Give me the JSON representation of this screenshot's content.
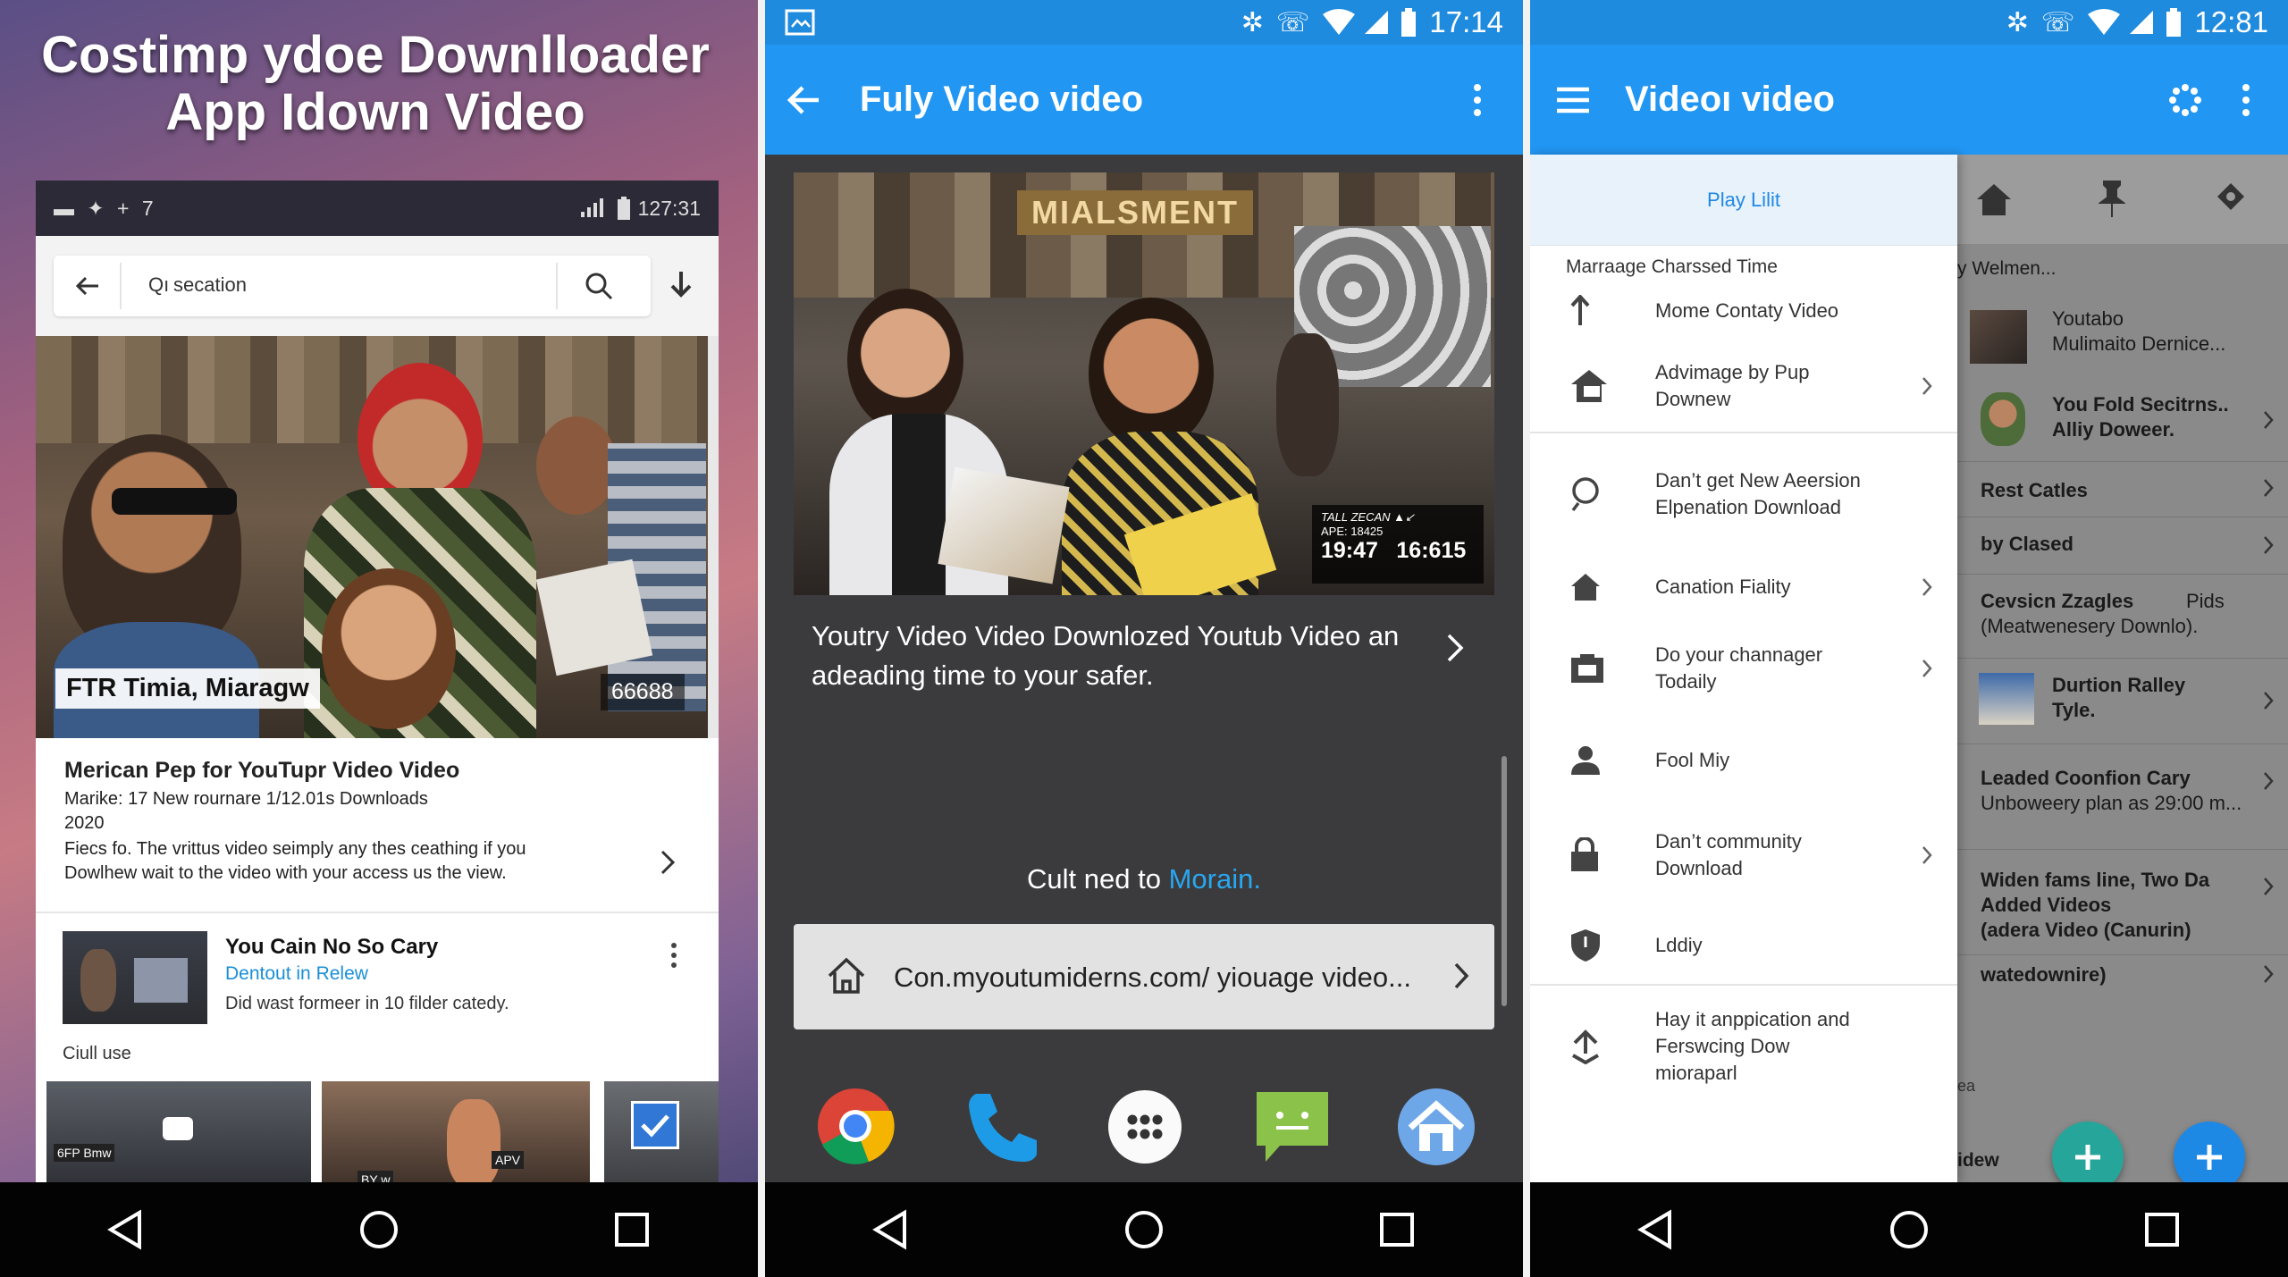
{
  "panel1": {
    "title_line1": "Costimp ydoe Downlloader",
    "title_line2": "App Idown Video",
    "status": {
      "left": "▬ ✦ + 7",
      "time": "127:31"
    },
    "search": {
      "query": "secation",
      "prefix": "Qı"
    },
    "hero": {
      "caption": "FTR Timia, Miaragw",
      "count": "66688"
    },
    "card": {
      "title": "Merican Pep for YouTupr Video Video",
      "meta": "Marike: 17 New rournare 1/12.01s Downloads",
      "year": "2020",
      "desc": "Fiecs fo. The vrittus video seimply any thes ceathing if you Dowlhew wait to the video with your access us the view."
    },
    "item": {
      "title": "You Cain No So Cary",
      "subtitle": "Dentout in Relew",
      "desc": "Did wast formeer in 10 filder catedy."
    },
    "section_label": "Ciull use",
    "thumbs": [
      "6FP  Bmw",
      "BY w",
      "APV"
    ]
  },
  "panel2": {
    "time": "17:14",
    "appbar_title": "Fuly Video video",
    "video": {
      "sign": "MIALSMENT",
      "overlay_label": "TALL ZECAN ▲↙",
      "overlay_sub": "APE: 18425",
      "time1": "19:47",
      "time2": "16:615"
    },
    "video_title": "Youtry Video Video Downlozed Youtub Video an adeading time to your safer.",
    "link_text_prefix": "Cult ned to ",
    "link_text_accent": "Morain.",
    "url": "Con.myoutumiderns.com/ yiouage video...",
    "dock": [
      "chrome-icon",
      "phone-icon",
      "apps-icon",
      "messages-icon",
      "home-app-icon"
    ]
  },
  "panel3": {
    "time": "12:81",
    "appbar_title": "Videoı video",
    "drawer": {
      "tab": "Play Lilit",
      "section": "Marraage Charssed Time",
      "items": [
        {
          "label": "Mome Contaty Video"
        },
        {
          "label": "Advimage by Pup Downew"
        },
        {
          "label": "Dan’t get New Aeersion Elpenation Download"
        },
        {
          "label": "Canation Fiality"
        },
        {
          "label": "Do your channager Todaily"
        },
        {
          "label": "Fool Miy"
        },
        {
          "label": "Dan’t community Download"
        },
        {
          "label": "Lddiy"
        },
        {
          "label": "Hay it anppication and Ferswcing Dow mioraparl"
        }
      ]
    },
    "right": {
      "header": "y  Welmen...",
      "items": [
        {
          "title": "Youtabo",
          "sub": "Mulimaito Dernice..."
        },
        {
          "title": "You Fold Secitrns..",
          "sub": "Alliy Doweer."
        },
        {
          "title": "Rest Catles",
          "sub": ""
        },
        {
          "title": "by Clased",
          "sub": ""
        },
        {
          "title": "Cevsicn Zzagles",
          "sub": "(Meatwenesery Downlo).",
          "tag": "Pids"
        },
        {
          "title": "Durtion Ralley",
          "sub": "Tyle."
        },
        {
          "title": "Leaded Coonfion Cary",
          "sub": "Unboweery plan as 29:00 m..."
        },
        {
          "title": "Widen fams line, Two Da Added Videos",
          "sub": "(adera Video (Canurin)"
        },
        {
          "title": "watedownire)",
          "sub": ""
        }
      ],
      "footer_a": "ea",
      "footer_b": "idew"
    }
  },
  "colors": {
    "primary": "#2196f3",
    "status": "#1f8bde",
    "accent_link": "#29a7f0",
    "fab_green": "#26a69a",
    "fab_blue": "#1e88e5"
  }
}
